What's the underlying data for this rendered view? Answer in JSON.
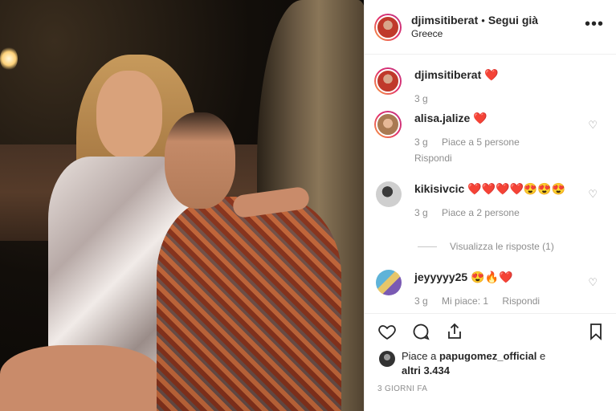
{
  "post": {
    "username": "djimsitiberat",
    "separator": "•",
    "follow_label": "Segui già",
    "location": "Greece",
    "more_icon": "more-horizontal-icon"
  },
  "caption": {
    "username": "djimsitiberat",
    "text": "❤️",
    "time": "3 g"
  },
  "comments": [
    {
      "username": "alisa.jalize",
      "text": "❤️",
      "time": "3 g",
      "likes": "Piace a 5 persone",
      "reply": "Rispondi"
    },
    {
      "username": "kikisivcic",
      "text": "❤️❤️❤️❤️😍😍😍",
      "time": "3 g",
      "likes": "Piace a 2 persone",
      "view_replies": "Visualizza le risposte (1)"
    },
    {
      "username": "jeyyyyy25",
      "text": "😍🔥❤️",
      "time": "3 g",
      "likes": "Mi piace: 1",
      "reply": "Rispondi"
    }
  ],
  "likes": {
    "text_prefix": "Piace a ",
    "liker": "papugomez_official",
    "text_mid": " e",
    "others": "altri 3.434"
  },
  "date": "3 GIORNI FA"
}
